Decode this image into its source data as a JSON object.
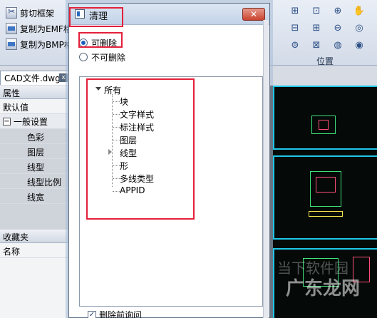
{
  "ribbon": {
    "items": [
      {
        "label": "剪切框架",
        "icon": "cut-frame-icon"
      },
      {
        "label": "复制为EMF格",
        "icon": "copy-emf-icon"
      },
      {
        "label": "复制为BMP格",
        "icon": "copy-bmp-icon"
      }
    ],
    "section_label": "位置",
    "tools": [
      "⊞",
      "⊡",
      "⊕",
      "✋",
      "⊟",
      "⊞",
      "⊖",
      "◎",
      "⊚",
      "⊠",
      "◍",
      "◉"
    ]
  },
  "document_tab": {
    "label": "CAD文件.dwg"
  },
  "properties": {
    "header": "属性",
    "default_row": "默认值",
    "group": "一般设置",
    "group_toggle": "−",
    "items": [
      "色彩",
      "图层",
      "线型",
      "线型比例",
      "线宽"
    ],
    "favorites_header": "收藏夹",
    "name_row": "名称"
  },
  "dialog": {
    "title": "清理",
    "close_label": "✕",
    "radio_deletable": "可删除",
    "radio_not_deletable": "不可删除",
    "tree": {
      "root": "所有",
      "children": [
        "块",
        "文字样式",
        "标注样式",
        "图层",
        "线型",
        "形",
        "多线类型",
        "APPID"
      ]
    },
    "confirm_checkbox": "删除前询问",
    "confirm_checked": "✓"
  },
  "watermark": {
    "text": "广东龙网",
    "bg_text": "当下软件园"
  },
  "colors": {
    "highlight": "#e3203a",
    "drawing_bg": "#050a08",
    "sheet_border": "#1fc7e8"
  }
}
